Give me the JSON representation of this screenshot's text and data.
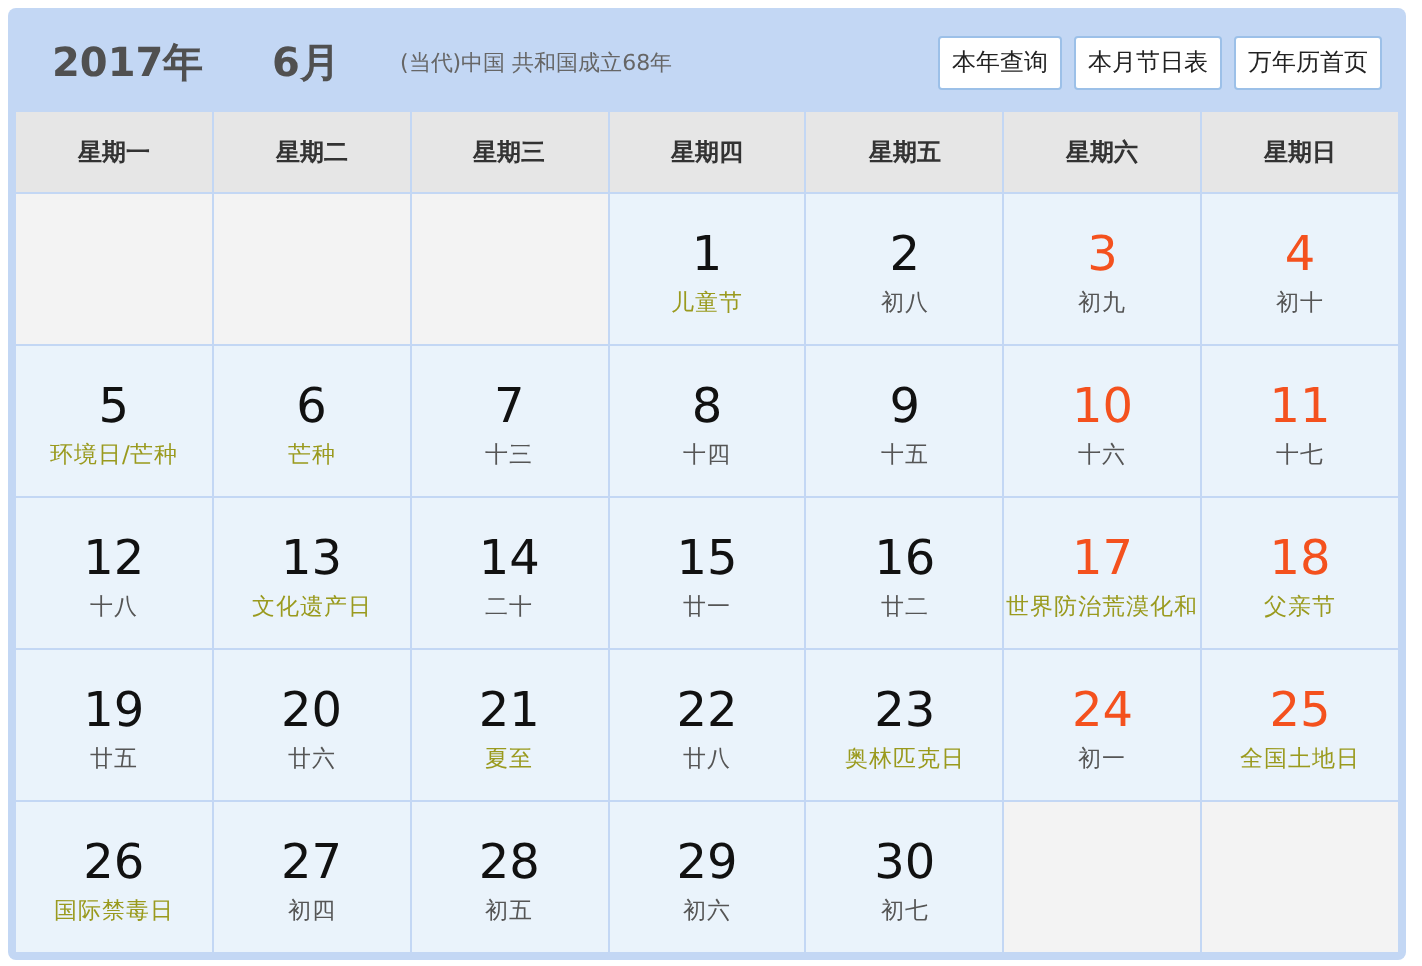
{
  "header": {
    "year": "2017年",
    "month": "6月",
    "era": "(当代)中国 共和国成立68年",
    "buttons": [
      "本年查询",
      "本月节日表",
      "万年历首页"
    ]
  },
  "weekdays": [
    "星期一",
    "星期二",
    "星期三",
    "星期四",
    "星期五",
    "星期六",
    "星期日"
  ],
  "days": [
    {
      "kind": "empty"
    },
    {
      "kind": "empty"
    },
    {
      "kind": "empty"
    },
    {
      "kind": "day",
      "day": "1",
      "sub": "儿童节",
      "festival": true,
      "weekend": false
    },
    {
      "kind": "day",
      "day": "2",
      "sub": "初八",
      "festival": false,
      "weekend": false
    },
    {
      "kind": "day",
      "day": "3",
      "sub": "初九",
      "festival": false,
      "weekend": true
    },
    {
      "kind": "day",
      "day": "4",
      "sub": "初十",
      "festival": false,
      "weekend": true
    },
    {
      "kind": "day",
      "day": "5",
      "sub": "环境日/芒种",
      "festival": true,
      "weekend": false
    },
    {
      "kind": "day",
      "day": "6",
      "sub": "芒种",
      "festival": true,
      "weekend": false
    },
    {
      "kind": "day",
      "day": "7",
      "sub": "十三",
      "festival": false,
      "weekend": false
    },
    {
      "kind": "day",
      "day": "8",
      "sub": "十四",
      "festival": false,
      "weekend": false
    },
    {
      "kind": "day",
      "day": "9",
      "sub": "十五",
      "festival": false,
      "weekend": false
    },
    {
      "kind": "day",
      "day": "10",
      "sub": "十六",
      "festival": false,
      "weekend": true
    },
    {
      "kind": "day",
      "day": "11",
      "sub": "十七",
      "festival": false,
      "weekend": true
    },
    {
      "kind": "day",
      "day": "12",
      "sub": "十八",
      "festival": false,
      "weekend": false
    },
    {
      "kind": "day",
      "day": "13",
      "sub": "文化遗产日",
      "festival": true,
      "weekend": false
    },
    {
      "kind": "day",
      "day": "14",
      "sub": "二十",
      "festival": false,
      "weekend": false
    },
    {
      "kind": "day",
      "day": "15",
      "sub": "廿一",
      "festival": false,
      "weekend": false
    },
    {
      "kind": "day",
      "day": "16",
      "sub": "廿二",
      "festival": false,
      "weekend": false
    },
    {
      "kind": "day",
      "day": "17",
      "sub": "世界防治荒漠化和",
      "festival": true,
      "weekend": true
    },
    {
      "kind": "day",
      "day": "18",
      "sub": "父亲节",
      "festival": true,
      "weekend": true
    },
    {
      "kind": "day",
      "day": "19",
      "sub": "廿五",
      "festival": false,
      "weekend": false
    },
    {
      "kind": "day",
      "day": "20",
      "sub": "廿六",
      "festival": false,
      "weekend": false
    },
    {
      "kind": "day",
      "day": "21",
      "sub": "夏至",
      "festival": true,
      "weekend": false
    },
    {
      "kind": "day",
      "day": "22",
      "sub": "廿八",
      "festival": false,
      "weekend": false
    },
    {
      "kind": "day",
      "day": "23",
      "sub": "奥林匹克日",
      "festival": true,
      "weekend": false
    },
    {
      "kind": "day",
      "day": "24",
      "sub": "初一",
      "festival": false,
      "weekend": true
    },
    {
      "kind": "day",
      "day": "25",
      "sub": "全国土地日",
      "festival": true,
      "weekend": true
    },
    {
      "kind": "day",
      "day": "26",
      "sub": "国际禁毒日",
      "festival": true,
      "weekend": false
    },
    {
      "kind": "day",
      "day": "27",
      "sub": "初四",
      "festival": false,
      "weekend": false
    },
    {
      "kind": "day",
      "day": "28",
      "sub": "初五",
      "festival": false,
      "weekend": false
    },
    {
      "kind": "day",
      "day": "29",
      "sub": "初六",
      "festival": false,
      "weekend": false
    },
    {
      "kind": "day",
      "day": "30",
      "sub": "初七",
      "festival": false,
      "weekend": false
    },
    {
      "kind": "empty"
    },
    {
      "kind": "empty"
    }
  ]
}
